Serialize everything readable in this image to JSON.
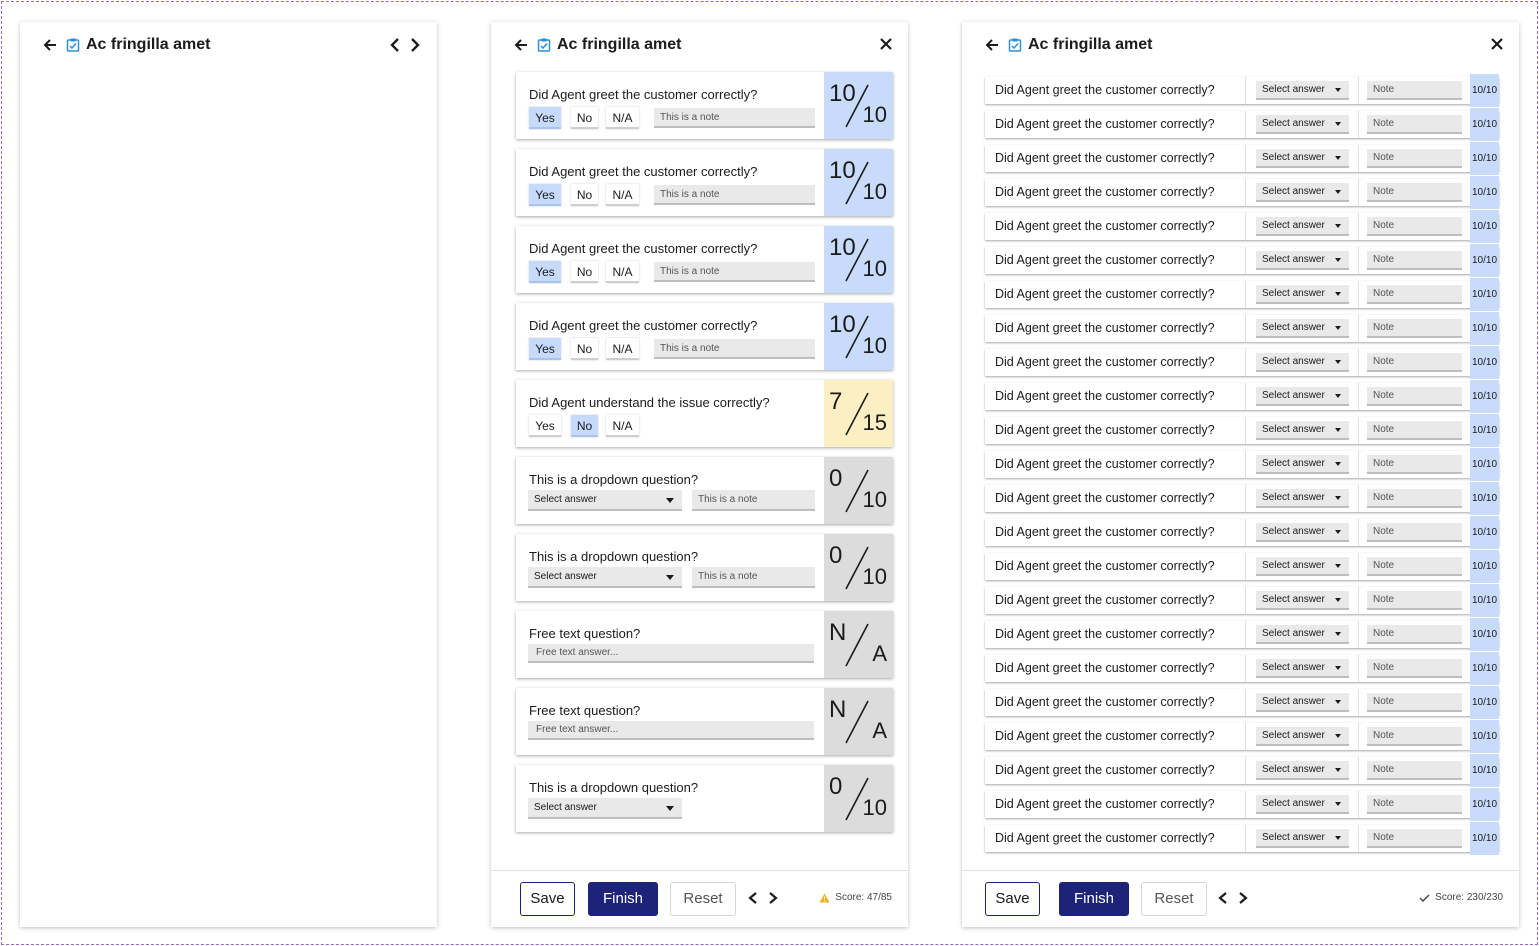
{
  "panels": {
    "left": {
      "title": "Ac fringilla amet"
    },
    "middle": {
      "title": "Ac fringilla amet",
      "cards": [
        {
          "kind": "yesno",
          "question": "Did Agent greet the customer correctly?",
          "options": [
            "Yes",
            "No",
            "N/A"
          ],
          "selected": "Yes",
          "note": "This is a note",
          "score_num": "10",
          "score_den": "10",
          "score_color": "blue"
        },
        {
          "kind": "yesno",
          "question": "Did Agent greet the customer correctly?",
          "options": [
            "Yes",
            "No",
            "N/A"
          ],
          "selected": "Yes",
          "note": "This is a note",
          "score_num": "10",
          "score_den": "10",
          "score_color": "blue"
        },
        {
          "kind": "yesno",
          "question": "Did Agent greet the customer correctly?",
          "options": [
            "Yes",
            "No",
            "N/A"
          ],
          "selected": "Yes",
          "note": "This is a note",
          "score_num": "10",
          "score_den": "10",
          "score_color": "blue"
        },
        {
          "kind": "yesno",
          "question": "Did Agent greet the customer correctly?",
          "options": [
            "Yes",
            "No",
            "N/A"
          ],
          "selected": "Yes",
          "note": "This is a note",
          "score_num": "10",
          "score_den": "10",
          "score_color": "blue"
        },
        {
          "kind": "yesno",
          "question": "Did Agent understand the issue correctly?",
          "options": [
            "Yes",
            "No",
            "N/A"
          ],
          "selected": "No",
          "note": "",
          "score_num": "7",
          "score_den": "15",
          "score_color": "yellow"
        },
        {
          "kind": "dropdown",
          "question": "This is a dropdown question?",
          "select": "Select answer",
          "note": "This is a note",
          "score_num": "0",
          "score_den": "10",
          "score_color": "gray"
        },
        {
          "kind": "dropdown",
          "question": "This is a dropdown question?",
          "select": "Select answer",
          "note": "This is a note",
          "score_num": "0",
          "score_den": "10",
          "score_color": "gray"
        },
        {
          "kind": "free",
          "question": "Free text question?",
          "placeholder": "Free text answer...",
          "score_num": "N",
          "score_den": "A",
          "score_color": "gray"
        },
        {
          "kind": "free",
          "question": "Free text question?",
          "placeholder": "Free text answer...",
          "score_num": "N",
          "score_den": "A",
          "score_color": "gray"
        },
        {
          "kind": "dropdown",
          "question": "This is a dropdown question?",
          "select": "Select answer",
          "note": "",
          "score_num": "0",
          "score_den": "10",
          "score_color": "gray"
        }
      ],
      "footer": {
        "save": "Save",
        "finish": "Finish",
        "reset": "Reset",
        "score": "Score: 47/85",
        "status_icon": "warning-icon"
      }
    },
    "right": {
      "title": "Ac fringilla amet",
      "rows": [
        {
          "question": "Did Agent greet the customer correctly?",
          "select": "Select answer",
          "note": "Note",
          "score": "10/10"
        },
        {
          "question": "Did Agent greet the customer correctly?",
          "select": "Select answer",
          "note": "Note",
          "score": "10/10"
        },
        {
          "question": "Did Agent greet the customer correctly?",
          "select": "Select answer",
          "note": "Note",
          "score": "10/10"
        },
        {
          "question": "Did Agent greet the customer correctly?",
          "select": "Select answer",
          "note": "Note",
          "score": "10/10"
        },
        {
          "question": "Did Agent greet the customer correctly?",
          "select": "Select answer",
          "note": "Note",
          "score": "10/10"
        },
        {
          "question": "Did Agent greet the customer correctly?",
          "select": "Select answer",
          "note": "Note",
          "score": "10/10"
        },
        {
          "question": "Did Agent greet the customer correctly?",
          "select": "Select answer",
          "note": "Note",
          "score": "10/10"
        },
        {
          "question": "Did Agent greet the customer correctly?",
          "select": "Select answer",
          "note": "Note",
          "score": "10/10"
        },
        {
          "question": "Did Agent greet the customer correctly?",
          "select": "Select answer",
          "note": "Note",
          "score": "10/10"
        },
        {
          "question": "Did Agent greet the customer correctly?",
          "select": "Select answer",
          "note": "Note",
          "score": "10/10"
        },
        {
          "question": "Did Agent greet the customer correctly?",
          "select": "Select answer",
          "note": "Note",
          "score": "10/10"
        },
        {
          "question": "Did Agent greet the customer correctly?",
          "select": "Select answer",
          "note": "Note",
          "score": "10/10"
        },
        {
          "question": "Did Agent greet the customer correctly?",
          "select": "Select answer",
          "note": "Note",
          "score": "10/10"
        },
        {
          "question": "Did Agent greet the customer correctly?",
          "select": "Select answer",
          "note": "Note",
          "score": "10/10"
        },
        {
          "question": "Did Agent greet the customer correctly?",
          "select": "Select answer",
          "note": "Note",
          "score": "10/10"
        },
        {
          "question": "Did Agent greet the customer correctly?",
          "select": "Select answer",
          "note": "Note",
          "score": "10/10"
        },
        {
          "question": "Did Agent greet the customer correctly?",
          "select": "Select answer",
          "note": "Note",
          "score": "10/10"
        },
        {
          "question": "Did Agent greet the customer correctly?",
          "select": "Select answer",
          "note": "Note",
          "score": "10/10"
        },
        {
          "question": "Did Agent greet the customer correctly?",
          "select": "Select answer",
          "note": "Note",
          "score": "10/10"
        },
        {
          "question": "Did Agent greet the customer correctly?",
          "select": "Select answer",
          "note": "Note",
          "score": "10/10"
        },
        {
          "question": "Did Agent greet the customer correctly?",
          "select": "Select answer",
          "note": "Note",
          "score": "10/10"
        },
        {
          "question": "Did Agent greet the customer correctly?",
          "select": "Select answer",
          "note": "Note",
          "score": "10/10"
        },
        {
          "question": "Did Agent greet the customer correctly?",
          "select": "Select answer",
          "note": "Note",
          "score": "10/10"
        }
      ],
      "footer": {
        "save": "Save",
        "finish": "Finish",
        "reset": "Reset",
        "score": "Score: 230/230",
        "status_icon": "check-icon"
      }
    }
  },
  "colors": {
    "primary": "#1e237a",
    "score_blue": "#c9dbfb",
    "score_yellow": "#fdefc4",
    "score_gray": "#dcdcdc",
    "selected_option": "#c6dafc",
    "warning": "#f2b01e",
    "checklist_icon": "#2f8fd8"
  }
}
